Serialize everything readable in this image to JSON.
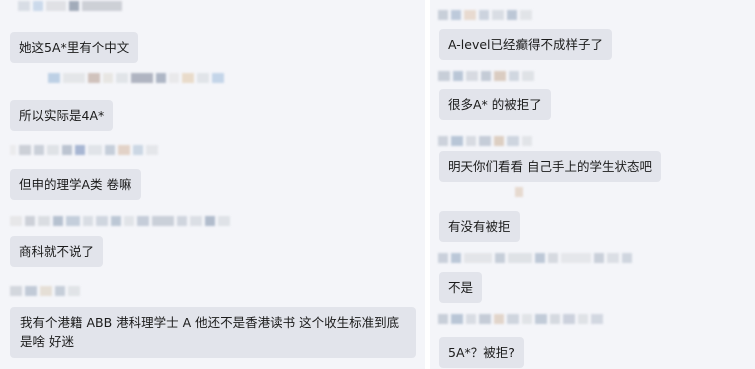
{
  "chat": {
    "left_messages": [
      {
        "text": "她这5A*里有个中文"
      },
      {
        "text": "所以实际是4A*"
      },
      {
        "text": "但申的理学A类 卷嘛"
      },
      {
        "text": "商科就不说了"
      },
      {
        "text": "我有个港籍 ABB 港科理学士 A 他还不是香港读书 这个收生标准到底是啥 好迷"
      }
    ],
    "right_messages": [
      {
        "text": "A-level已经癫得不成样子了"
      },
      {
        "text": "很多A* 的被拒了"
      },
      {
        "text": "明天你们看看 自己手上的学生状态吧"
      },
      {
        "text": "有没有被拒"
      },
      {
        "text": "不是"
      },
      {
        "text": "5A*？被拒?"
      }
    ]
  },
  "colors": {
    "background": "#f4f5f9",
    "bubble": "#e2e4eb",
    "divider": "#ffffff",
    "text": "#1b1b1b"
  }
}
